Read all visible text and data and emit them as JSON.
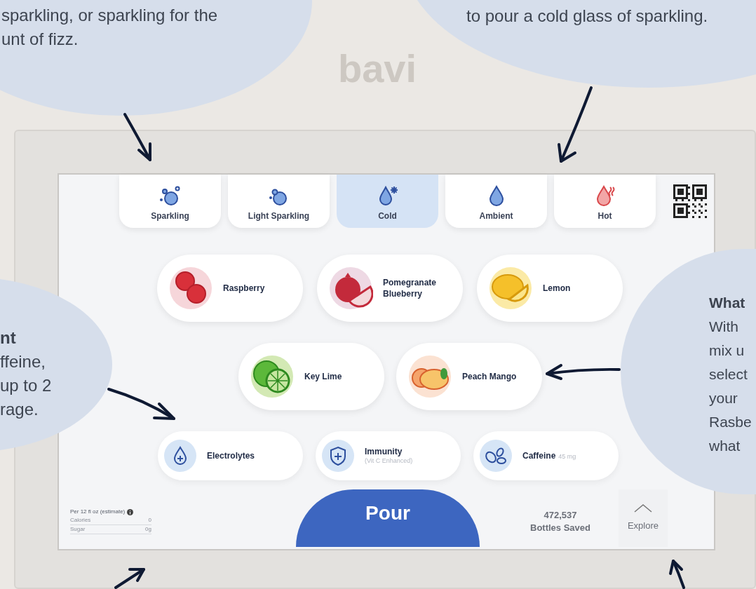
{
  "brand": "bavi",
  "callouts": [
    {
      "kind": "top-left",
      "lines": [
        "sparkling, or sparkling for the",
        "unt of fizz."
      ]
    },
    {
      "kind": "top-right",
      "lines": [
        "to pour a cold glass of sparkling."
      ]
    },
    {
      "kind": "left",
      "heading": "nt",
      "lines": [
        "ffeine,",
        "up to 2",
        "rage."
      ]
    },
    {
      "kind": "right",
      "heading": "What",
      "lines": [
        "With",
        "mix u",
        "select",
        "your",
        "Rasbe",
        "what"
      ]
    }
  ],
  "temperatures": [
    {
      "label": "Sparkling",
      "kind": "sparkling",
      "selected": false
    },
    {
      "label": "Light Sparkling",
      "kind": "light",
      "selected": false
    },
    {
      "label": "Cold",
      "kind": "cold",
      "selected": true
    },
    {
      "label": "Ambient",
      "kind": "ambient",
      "selected": false
    },
    {
      "label": "Hot",
      "kind": "hot",
      "selected": false
    }
  ],
  "flavor_rows": [
    [
      {
        "name": "Raspberry",
        "kind": "raspberry",
        "color": "#f6d6da",
        "selected": false
      },
      {
        "name": "Pomegranate Blueberry",
        "kind": "pomegranate",
        "color": "#eed9e4",
        "selected": false
      },
      {
        "name": "Lemon",
        "kind": "lemon",
        "color": "#fbeaa6",
        "selected": false
      }
    ],
    [
      {
        "name": "Key Lime",
        "kind": "lime",
        "color": "#d3e9b4",
        "selected": false
      },
      {
        "name": "Peach Mango",
        "kind": "mango",
        "color": "#fbe2d2",
        "selected": false
      }
    ]
  ],
  "boosts": [
    {
      "name": "Electrolytes",
      "kind": "electrolytes",
      "selected": false
    },
    {
      "name": "Immunity",
      "detail": "(Vit C Enhanced)",
      "kind": "immunity",
      "selected": false
    },
    {
      "name": "Caffeine",
      "detail": "45 mg",
      "kind": "caffeine",
      "selected": false
    }
  ],
  "nutrition": {
    "heading": "Per 12 fl oz (estimate)",
    "rows": [
      {
        "label": "Calories",
        "value": "0"
      },
      {
        "label": "Sugar",
        "value": "0g"
      }
    ]
  },
  "pour_button": "Pour",
  "bottles_saved": {
    "count": "472,537",
    "label": "Bottles Saved"
  },
  "explore": "Explore"
}
